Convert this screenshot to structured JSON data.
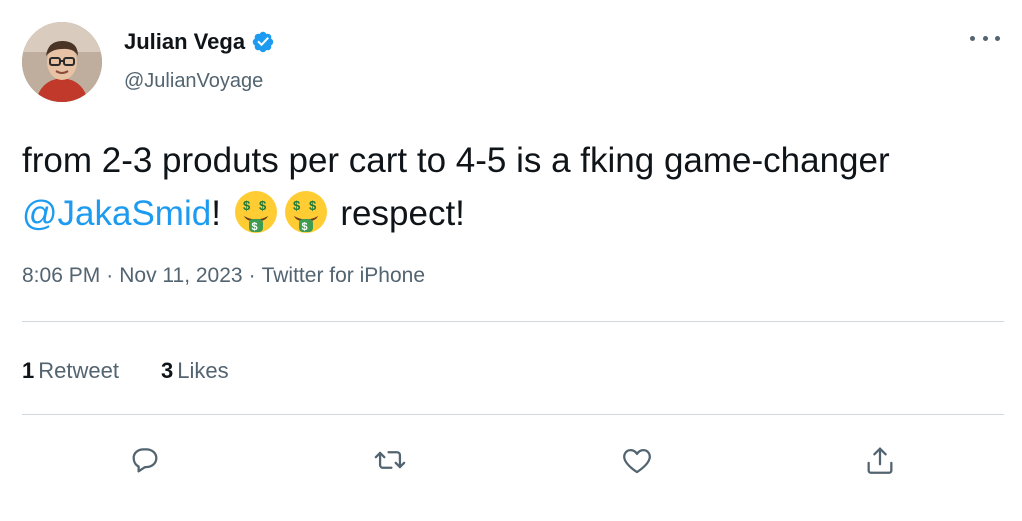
{
  "author": {
    "name": "Julian Vega",
    "handle": "@JulianVoyage",
    "verified": true,
    "avatar_icon": "avatar-photo"
  },
  "tweet": {
    "text_part1": "from 2-3 produts per cart to 4-5 is a fking game-changer ",
    "mention": "@JakaSmid",
    "text_part2": "!",
    "emoji": [
      "money-mouth-face",
      "money-mouth-face"
    ],
    "text_part3": " respect!"
  },
  "meta": {
    "time": "8:06 PM",
    "separator": "·",
    "date": "Nov 11, 2023",
    "source": "Twitter for iPhone"
  },
  "stats": {
    "retweets_count": "1",
    "retweets_label": "Retweet",
    "likes_count": "3",
    "likes_label": "Likes"
  },
  "actions": [
    "reply-icon",
    "retweet-icon",
    "like-icon",
    "share-icon"
  ],
  "colors": {
    "link": "#1d9bf0",
    "secondary_text": "#536471",
    "divider": "#cfd9de",
    "verified_badge": "#1d9bf0"
  }
}
